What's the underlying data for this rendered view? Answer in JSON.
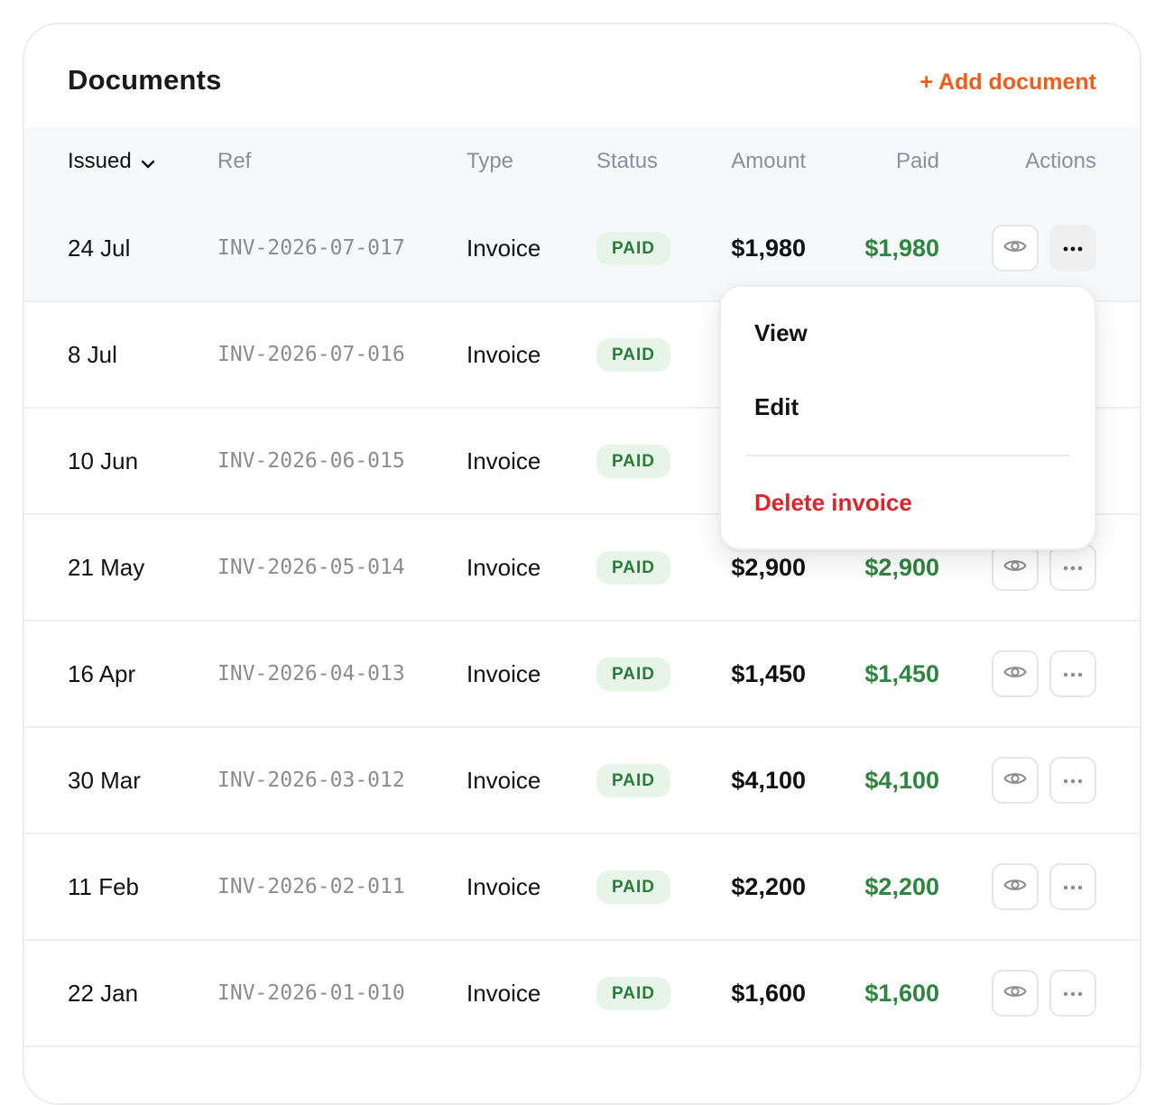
{
  "header": {
    "title": "Documents",
    "add_label": "+ Add document"
  },
  "columns": {
    "issued": "Issued",
    "ref": "Ref",
    "type": "Type",
    "status": "Status",
    "amount": "Amount",
    "paid": "Paid",
    "actions": "Actions"
  },
  "rows": [
    {
      "issued": "24 Jul",
      "ref": "INV-2026-07-017",
      "type": "Invoice",
      "status": "PAID",
      "amount": "$1,980",
      "paid": "$1,980"
    },
    {
      "issued": "8 Jul",
      "ref": "INV-2026-07-016",
      "type": "Invoice",
      "status": "PAID",
      "amount": "",
      "paid": ""
    },
    {
      "issued": "10 Jun",
      "ref": "INV-2026-06-015",
      "type": "Invoice",
      "status": "PAID",
      "amount": "",
      "paid": ""
    },
    {
      "issued": "21 May",
      "ref": "INV-2026-05-014",
      "type": "Invoice",
      "status": "PAID",
      "amount": "$2,900",
      "paid": "$2,900"
    },
    {
      "issued": "16 Apr",
      "ref": "INV-2026-04-013",
      "type": "Invoice",
      "status": "PAID",
      "amount": "$1,450",
      "paid": "$1,450"
    },
    {
      "issued": "30 Mar",
      "ref": "INV-2026-03-012",
      "type": "Invoice",
      "status": "PAID",
      "amount": "$4,100",
      "paid": "$4,100"
    },
    {
      "issued": "11 Feb",
      "ref": "INV-2026-02-011",
      "type": "Invoice",
      "status": "PAID",
      "amount": "$2,200",
      "paid": "$2,200"
    },
    {
      "issued": "22 Jan",
      "ref": "INV-2026-01-010",
      "type": "Invoice",
      "status": "PAID",
      "amount": "$1,600",
      "paid": "$1,600"
    }
  ],
  "menu": {
    "view": "View",
    "edit": "Edit",
    "delete": "Delete invoice"
  },
  "icons": {
    "view": "eye-icon",
    "more": "more-horizontal-icon",
    "sort": "chevron-down-icon"
  },
  "colors": {
    "accent": "#f25c19",
    "paid_text": "#2e8540",
    "badge_bg": "#e7f5e9",
    "badge_text": "#2b7a3a",
    "danger": "#d9262b"
  }
}
